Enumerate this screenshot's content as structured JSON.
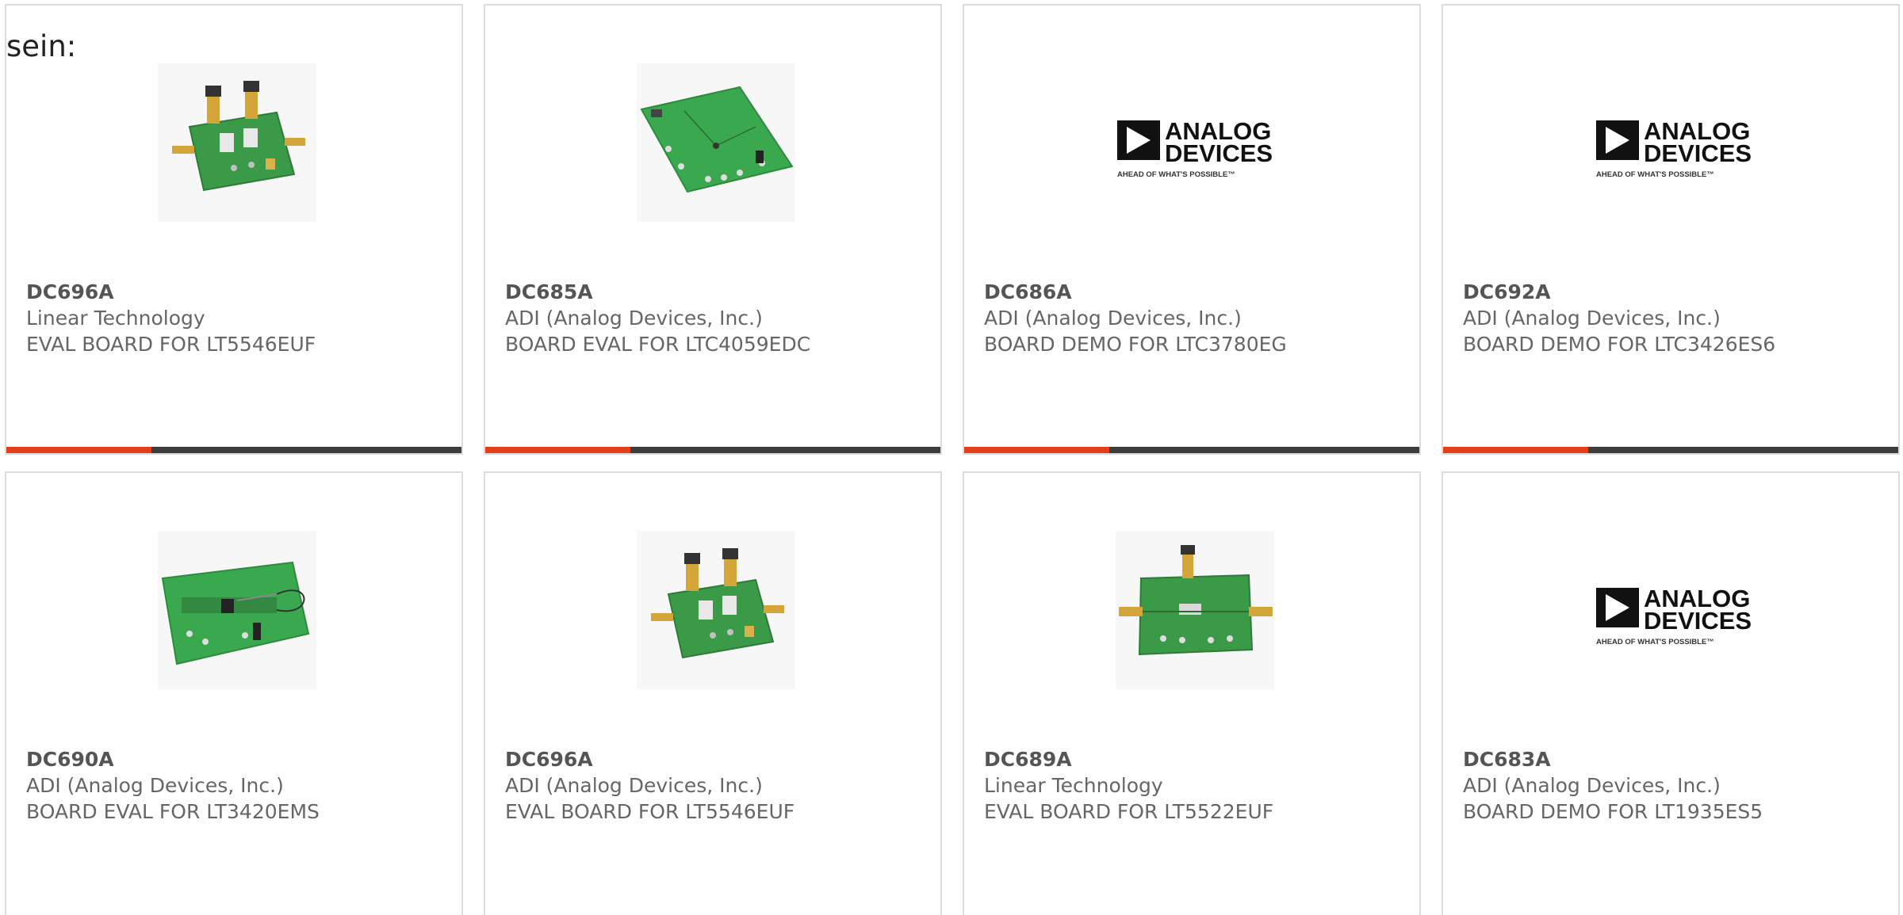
{
  "prefix_text": "sein:",
  "colors": {
    "accent": "#e2401b",
    "dark_bar": "#3d3d3d",
    "border": "#dcdcdc",
    "board_green": "#3aa24a"
  },
  "products": [
    {
      "part": "DC696A",
      "manufacturer": "Linear Technology",
      "description": "EVAL BOARD FOR LT5546EUF",
      "image": "board-photo-rf-two-sma"
    },
    {
      "part": "DC685A",
      "manufacturer": "ADI (Analog Devices, Inc.)",
      "description": "BOARD EVAL FOR LTC4059EDC",
      "image": "board-photo-flat"
    },
    {
      "part": "DC686A",
      "manufacturer": "ADI (Analog Devices, Inc.)",
      "description": "BOARD DEMO FOR LTC3780EG",
      "image": "analog-devices-logo"
    },
    {
      "part": "DC692A",
      "manufacturer": "ADI (Analog Devices, Inc.)",
      "description": "BOARD DEMO FOR LTC3426ES6",
      "image": "analog-devices-logo"
    },
    {
      "part": "DC690A",
      "manufacturer": "ADI (Analog Devices, Inc.)",
      "description": "BOARD EVAL FOR LT3420EMS",
      "image": "board-photo-long"
    },
    {
      "part": "DC696A",
      "manufacturer": "ADI (Analog Devices, Inc.)",
      "description": "EVAL BOARD FOR LT5546EUF",
      "image": "board-photo-rf-two-sma"
    },
    {
      "part": "DC689A",
      "manufacturer": "Linear Technology",
      "description": "EVAL BOARD FOR LT5522EUF",
      "image": "board-photo-rf-sma"
    },
    {
      "part": "DC683A",
      "manufacturer": "ADI (Analog Devices, Inc.)",
      "description": "BOARD DEMO FOR LT1935ES5",
      "image": "analog-devices-logo"
    }
  ],
  "logo": {
    "line1": "ANALOG",
    "line2": "DEVICES",
    "tagline": "AHEAD OF WHAT'S POSSIBLE™"
  }
}
